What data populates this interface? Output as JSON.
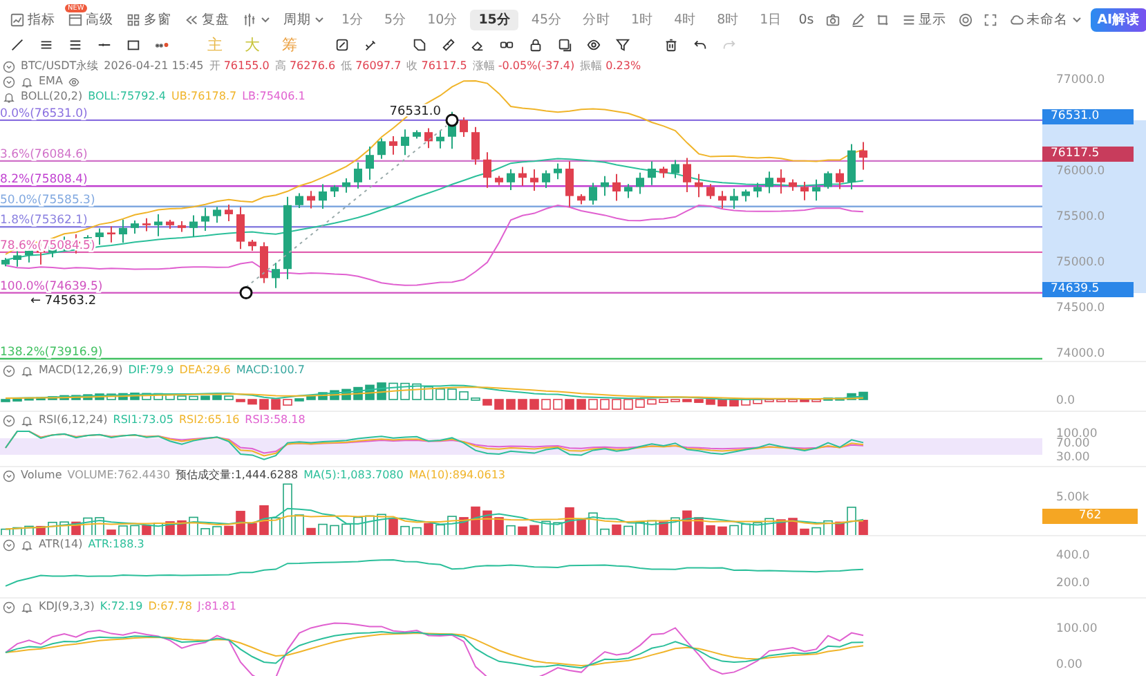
{
  "toolbar": {
    "menu": [
      {
        "label": "指标"
      },
      {
        "label": "高级",
        "badge": "NEW"
      },
      {
        "label": "多窗"
      },
      {
        "label": "复盘"
      }
    ],
    "period_menu": "周期",
    "periods": [
      {
        "label": "1分",
        "selected": false
      },
      {
        "label": "5分",
        "selected": false
      },
      {
        "label": "10分",
        "selected": false
      },
      {
        "label": "15分",
        "selected": true
      },
      {
        "label": "45分",
        "selected": false
      },
      {
        "label": "分时",
        "selected": false
      },
      {
        "label": "1时",
        "selected": false
      },
      {
        "label": "4时",
        "selected": false
      },
      {
        "label": "8时",
        "selected": false
      },
      {
        "label": "1日",
        "selected": false
      }
    ],
    "timer": "0s",
    "display": "显示",
    "layout": "未命名",
    "ai_button": "AI解读"
  },
  "drawing_toolbar": {
    "overlay_buttons": [
      {
        "label": "主",
        "color": "#e8b84a"
      },
      {
        "label": "大",
        "color": "#c8c43a"
      },
      {
        "label": "筹",
        "color": "#eba040"
      }
    ],
    "redo_disabled": true
  },
  "quote": {
    "symbol": "BTC/USDT永续",
    "time": "2026-04-21 15:45",
    "fields": [
      {
        "label": "开",
        "value": "76155.0"
      },
      {
        "label": "高",
        "value": "76276.6"
      },
      {
        "label": "低",
        "value": "76097.7"
      },
      {
        "label": "收",
        "value": "76117.5"
      },
      {
        "label": "涨幅",
        "value": "-0.05%(-37.4)"
      },
      {
        "label": "振幅",
        "value": "0.23%"
      }
    ]
  },
  "main_indicators": [
    {
      "name": "EMA"
    },
    {
      "name": "BOLL(20,2)",
      "values": [
        {
          "text": "BOLL:75792.4",
          "color": "#2bbf9a"
        },
        {
          "text": "UB:76178.7",
          "color": "#f0b429"
        },
        {
          "text": "LB:75406.1",
          "color": "#e060d0"
        }
      ]
    }
  ],
  "fib_levels": [
    {
      "label": "0.0%(76531.0)",
      "color": "#8a70e0"
    },
    {
      "label": "3.6%(76084.6)",
      "color": "#d070c8"
    },
    {
      "label": "8.2%(75808.4)",
      "color": "#c040d0"
    },
    {
      "label": "50.0%(75585.3)",
      "color": "#80a8e0"
    },
    {
      "label": "1.8%(75362.1)",
      "color": "#8a80e0"
    },
    {
      "label": "78.6%(75084.5)",
      "color": "#e060b0"
    },
    {
      "label": "100.0%(74639.5)",
      "color": "#d050c0"
    },
    {
      "label": "138.2%(73916.9)",
      "color": "#40c060"
    }
  ],
  "markers": {
    "high": "76531.0",
    "low": "← 74563.2"
  },
  "price_axis": [
    "77000.0",
    "76000.0",
    "75500.0",
    "75000.0",
    "74500.0",
    "74000.0"
  ],
  "price_badges": [
    {
      "text": "76531.0",
      "kind": "level"
    },
    {
      "text": "76117.5",
      "kind": "last"
    },
    {
      "text": "74639.5",
      "kind": "level"
    }
  ],
  "panes": [
    {
      "kind": "macd",
      "name": "MACD(12,26,9)",
      "values": [
        {
          "text": "DIF:79.9",
          "color": "#2bbf9a"
        },
        {
          "text": "DEA:29.6",
          "color": "#f0b429"
        },
        {
          "text": "MACD:100.7",
          "color": "#3aa8a0"
        }
      ],
      "axis": [
        "0.0"
      ]
    },
    {
      "kind": "rsi",
      "name": "RSI(6,12,24)",
      "values": [
        {
          "text": "RSI1:73.05",
          "color": "#2bbf9a"
        },
        {
          "text": "RSI2:65.16",
          "color": "#f0b429"
        },
        {
          "text": "RSI3:58.18",
          "color": "#e060d0"
        }
      ],
      "axis": [
        "100.00",
        "70.00",
        "30.00"
      ]
    },
    {
      "kind": "volume",
      "name": "Volume",
      "values": [
        {
          "text": "VOLUME:762.4430",
          "color": "#999999"
        },
        {
          "text": "预估成交量:1,444.6288",
          "color": "#444444"
        },
        {
          "text": "MA(5):1,083.7080",
          "color": "#2bbf9a"
        },
        {
          "text": "MA(10):894.0613",
          "color": "#f0b429"
        }
      ],
      "axis": [
        "5.00k"
      ],
      "badge": "762"
    },
    {
      "kind": "atr",
      "name": "ATR(14)",
      "values": [
        {
          "text": "ATR:188.3",
          "color": "#2bbf9a"
        }
      ],
      "axis": [
        "400.0",
        "200.0"
      ]
    },
    {
      "kind": "kdj",
      "name": "KDJ(9,3,3)",
      "values": [
        {
          "text": "K:72.19",
          "color": "#2bbf9a"
        },
        {
          "text": "D:67.78",
          "color": "#f0b429"
        },
        {
          "text": "J:81.81",
          "color": "#e060d0"
        }
      ],
      "axis": [
        "100.00",
        "0.00"
      ]
    }
  ]
}
